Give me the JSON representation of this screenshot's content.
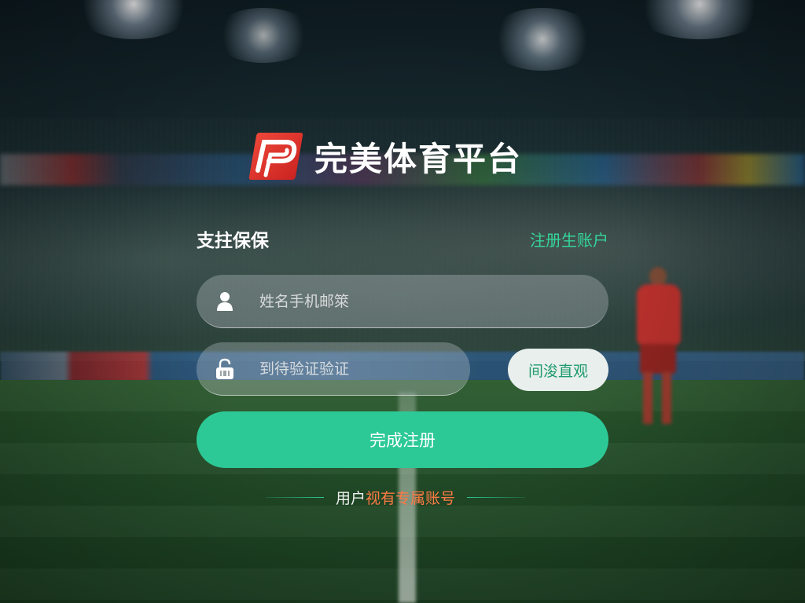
{
  "brand": {
    "name": "完美体育平台",
    "logo_color": "#e5382f"
  },
  "form": {
    "title": "支拄保保",
    "register_link": "注册生账户",
    "account_field": {
      "placeholder": "姓名手机邮箂",
      "icon": "user-icon"
    },
    "code_field": {
      "placeholder": "到待验证验证",
      "icon": "lock-icon"
    },
    "code_button": "间浚直观",
    "submit": "完成注册"
  },
  "footer": {
    "prefix": "用户",
    "link": "视有专属账号"
  },
  "colors": {
    "accent": "#2cc996",
    "link_orange": "#ff7a45",
    "register_green": "#34d69b"
  }
}
